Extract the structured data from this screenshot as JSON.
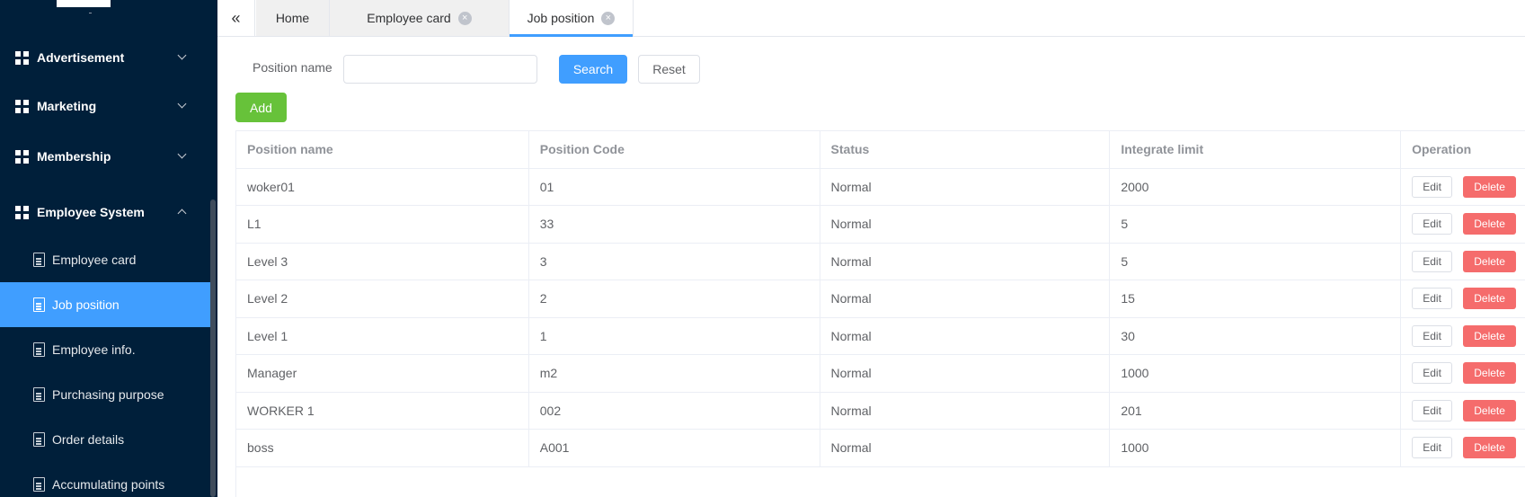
{
  "sidebar": {
    "groups": [
      {
        "label": "Advertisement"
      },
      {
        "label": "Marketing"
      },
      {
        "label": "Membership"
      },
      {
        "label": "Employee System"
      }
    ],
    "items": [
      {
        "label": "Employee card"
      },
      {
        "label": "Job position"
      },
      {
        "label": "Employee info."
      },
      {
        "label": "Purchasing purpose"
      },
      {
        "label": "Order details"
      },
      {
        "label": "Accumulating points"
      }
    ],
    "active_item": "Job position"
  },
  "tabs": {
    "collapse_glyph": "«",
    "items": [
      {
        "label": "Home"
      },
      {
        "label": "Employee card"
      },
      {
        "label": "Job position"
      }
    ],
    "close_glyph": "×",
    "active": "Job position"
  },
  "search": {
    "label": "Position name",
    "value": "",
    "search_button": "Search",
    "reset_button": "Reset",
    "add_button": "Add"
  },
  "table": {
    "headers": [
      "Position name",
      "Position Code",
      "Status",
      "Integrate limit",
      "Operation"
    ],
    "rows": [
      [
        "woker01",
        "01",
        "Normal",
        "2000"
      ],
      [
        "L1",
        "33",
        "Normal",
        "5"
      ],
      [
        "Level 3",
        "3",
        "Normal",
        "5"
      ],
      [
        "Level 2",
        "2",
        "Normal",
        "15"
      ],
      [
        "Level 1",
        "1",
        "Normal",
        "30"
      ],
      [
        "Manager",
        "m2",
        "Normal",
        "1000"
      ],
      [
        "WORKER 1",
        "002",
        "Normal",
        "201"
      ],
      [
        "boss",
        "A001",
        "Normal",
        "1000"
      ]
    ],
    "edit_label": "Edit",
    "delete_label": "Delete"
  },
  "colors": {
    "sidebar_bg": "#001f3a",
    "active": "#409eff",
    "add": "#67c23a",
    "delete": "#f56c6c"
  }
}
